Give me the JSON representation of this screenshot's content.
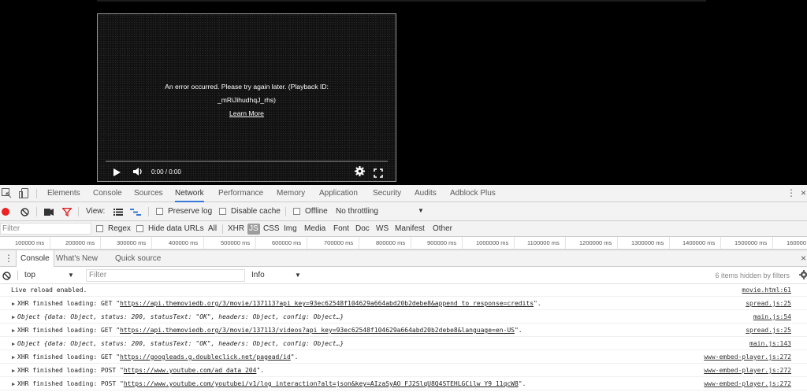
{
  "player": {
    "error_line1": "An error occurred. Please try again later. (Playback ID:",
    "error_line2": "_mRiJihudhqJ_rhs)",
    "learn_more": "Learn More",
    "time": "0:00 / 0:00"
  },
  "devtools": {
    "tabs": [
      "Elements",
      "Console",
      "Sources",
      "Network",
      "Performance",
      "Memory",
      "Application",
      "Security",
      "Audits",
      "Adblock Plus"
    ],
    "active_tab": "Network",
    "network_toolbar": {
      "view_label": "View:",
      "preserve_log": "Preserve log",
      "disable_cache": "Disable cache",
      "offline": "Offline",
      "throttling": "No throttling"
    },
    "filter": {
      "placeholder": "Filter",
      "regex": "Regex",
      "hide_data_urls": "Hide data URLs",
      "types": [
        "All",
        "XHR",
        "JS",
        "CSS",
        "Img",
        "Media",
        "Font",
        "Doc",
        "WS",
        "Manifest",
        "Other"
      ],
      "selected_type": "JS"
    },
    "timeline_ticks": [
      "100000 ms",
      "200000 ms",
      "300000 ms",
      "400000 ms",
      "500000 ms",
      "600000 ms",
      "700000 ms",
      "800000 ms",
      "900000 ms",
      "1000000 ms",
      "1100000 ms",
      "1200000 ms",
      "1300000 ms",
      "1400000 ms",
      "1500000 ms",
      "160000"
    ],
    "drawer_tabs": [
      "Console",
      "What's New",
      "Quick source"
    ],
    "console_toolbar": {
      "context": "top",
      "filter_placeholder": "Filter",
      "level": "Info",
      "hidden_count": "6 items hidden by filters"
    },
    "console_logs": [
      {
        "arrow": false,
        "text": "Live reload enabled.",
        "source": "movie.html:61"
      },
      {
        "arrow": true,
        "prefix": "XHR finished loading: GET \"",
        "url": "https://api.themoviedb.org/3/movie/137113?api_key=93ec62548f104629a664abd20b2debe8&append_to_response=credits",
        "suffix": "\".",
        "source": "spread.js:25"
      },
      {
        "arrow": true,
        "object": true,
        "text": "Object {data: Object, status: 200, statusText: \"OK\", headers: Object, config: Object…}",
        "source": "main.js:54"
      },
      {
        "arrow": true,
        "prefix": "XHR finished loading: GET \"",
        "url": "https://api.themoviedb.org/3/movie/137113/videos?api_key=93ec62548f104629a664abd20b2debe8&language=en-US",
        "suffix": "\".",
        "source": "spread.js:25"
      },
      {
        "arrow": true,
        "object": true,
        "text": "Object {data: Object, status: 200, statusText: \"OK\", headers: Object, config: Object…}",
        "source": "main.js:143"
      },
      {
        "arrow": true,
        "prefix": "XHR finished loading: GET \"",
        "url": "https://googleads.g.doubleclick.net/pagead/id",
        "suffix": "\".",
        "source": "www-embed-player.js:272"
      },
      {
        "arrow": true,
        "prefix": "XHR finished loading: POST \"",
        "url": "https://www.youtube.com/ad_data_204",
        "suffix": "\".",
        "source": "www-embed-player.js:272"
      },
      {
        "arrow": true,
        "prefix": "XHR finished loading: POST \"",
        "url": "https://www.youtube.com/youtubei/v1/log_interaction?alt=json&key=AIzaSyAO_FJ2SlqU8Q4STEHLGCilw_Y9_11qcW8",
        "suffix": "\".",
        "source": "www-embed-player.js:272"
      }
    ]
  },
  "colors": {
    "accent": "#3879d9",
    "record_red": "#e22",
    "filter_red": "#d22"
  }
}
